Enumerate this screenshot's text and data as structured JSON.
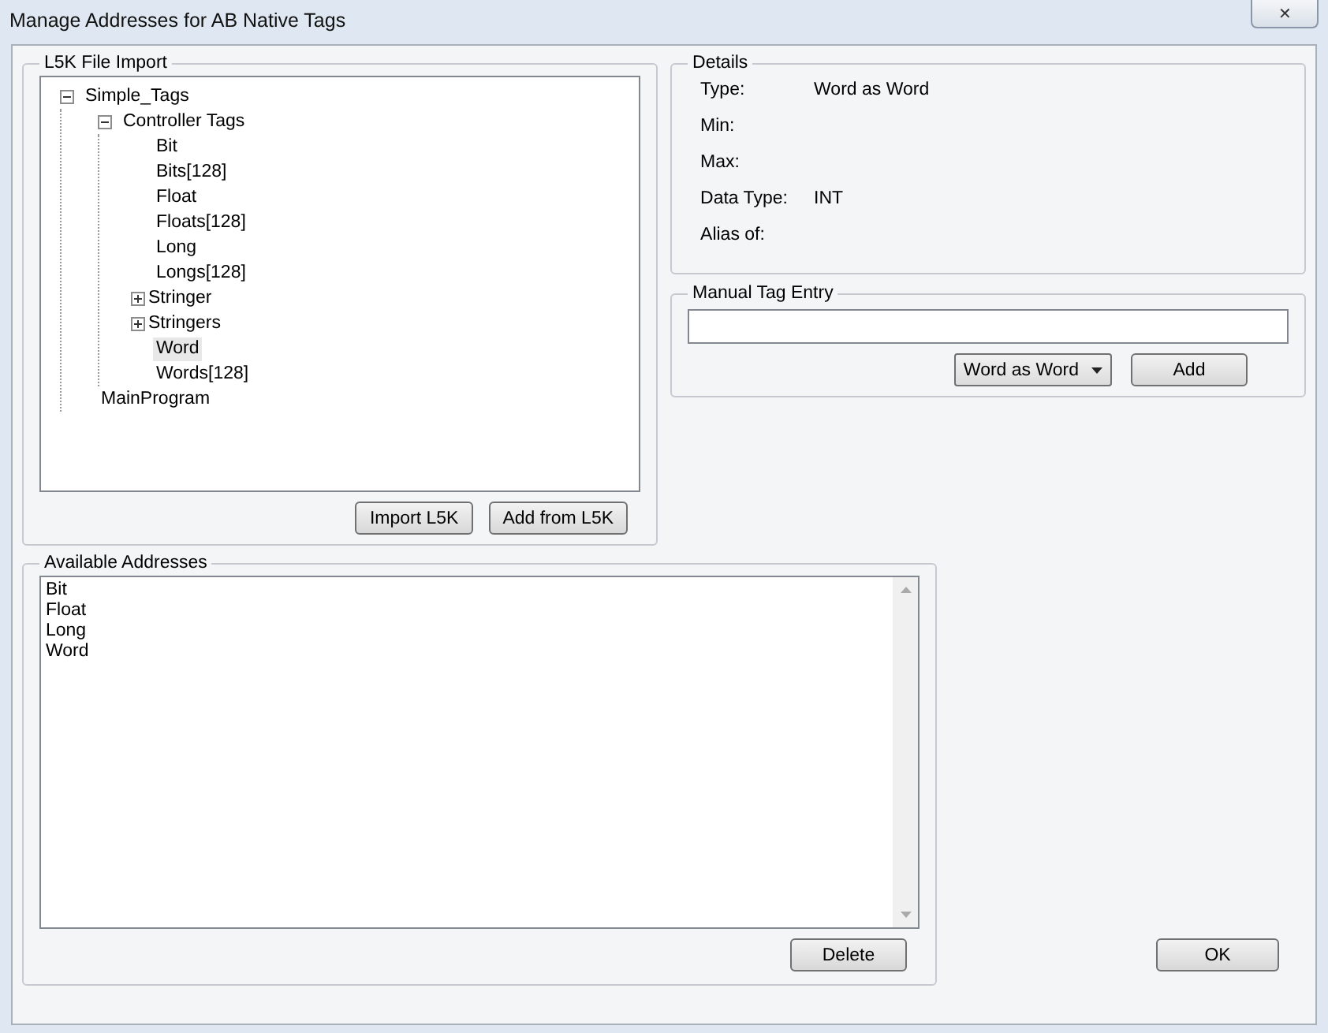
{
  "window": {
    "title": "Manage Addresses for AB Native Tags",
    "close": "✕"
  },
  "l5k_import": {
    "title": "L5K File Import",
    "tree": [
      {
        "label": "Simple_Tags",
        "selected": false,
        "expanded": true,
        "children": [
          {
            "label": "Controller Tags",
            "selected": false,
            "expanded": true,
            "children": [
              {
                "label": "Bit",
                "selected": false
              },
              {
                "label": "Bits[128]",
                "selected": false
              },
              {
                "label": "Float",
                "selected": false
              },
              {
                "label": "Floats[128]",
                "selected": false
              },
              {
                "label": "Long",
                "selected": false
              },
              {
                "label": "Longs[128]",
                "selected": false
              },
              {
                "label": "Stringer",
                "selected": false,
                "expanded": false
              },
              {
                "label": "Stringers",
                "selected": false,
                "expanded": false
              },
              {
                "label": "Word",
                "selected": true
              },
              {
                "label": "Words[128]",
                "selected": false
              }
            ]
          },
          {
            "label": "MainProgram",
            "selected": false
          }
        ]
      }
    ],
    "buttons": [
      "Import L5K",
      "Add from L5K"
    ]
  },
  "details": {
    "title": "Details",
    "fields": [
      {
        "label": "Type:",
        "value": "Word as Word"
      },
      {
        "label": "Min:"
      },
      {
        "label": "Max:"
      },
      {
        "label": "Data Type:",
        "value": "INT"
      },
      {
        "label": "Alias of:"
      }
    ]
  },
  "manual_tag_entry": {
    "title": "Manual Tag Entry",
    "type_dropdown": "Word as Word",
    "add_button": "Add"
  },
  "available_addresses": {
    "title": "Available Addresses",
    "items": [
      {
        "label": "Bit",
        "selected": false
      },
      {
        "label": "Float",
        "selected": false
      },
      {
        "label": "Long",
        "selected": false
      },
      {
        "label": "Word",
        "selected": false
      }
    ],
    "delete_button": "Delete"
  },
  "ok_button": "OK"
}
